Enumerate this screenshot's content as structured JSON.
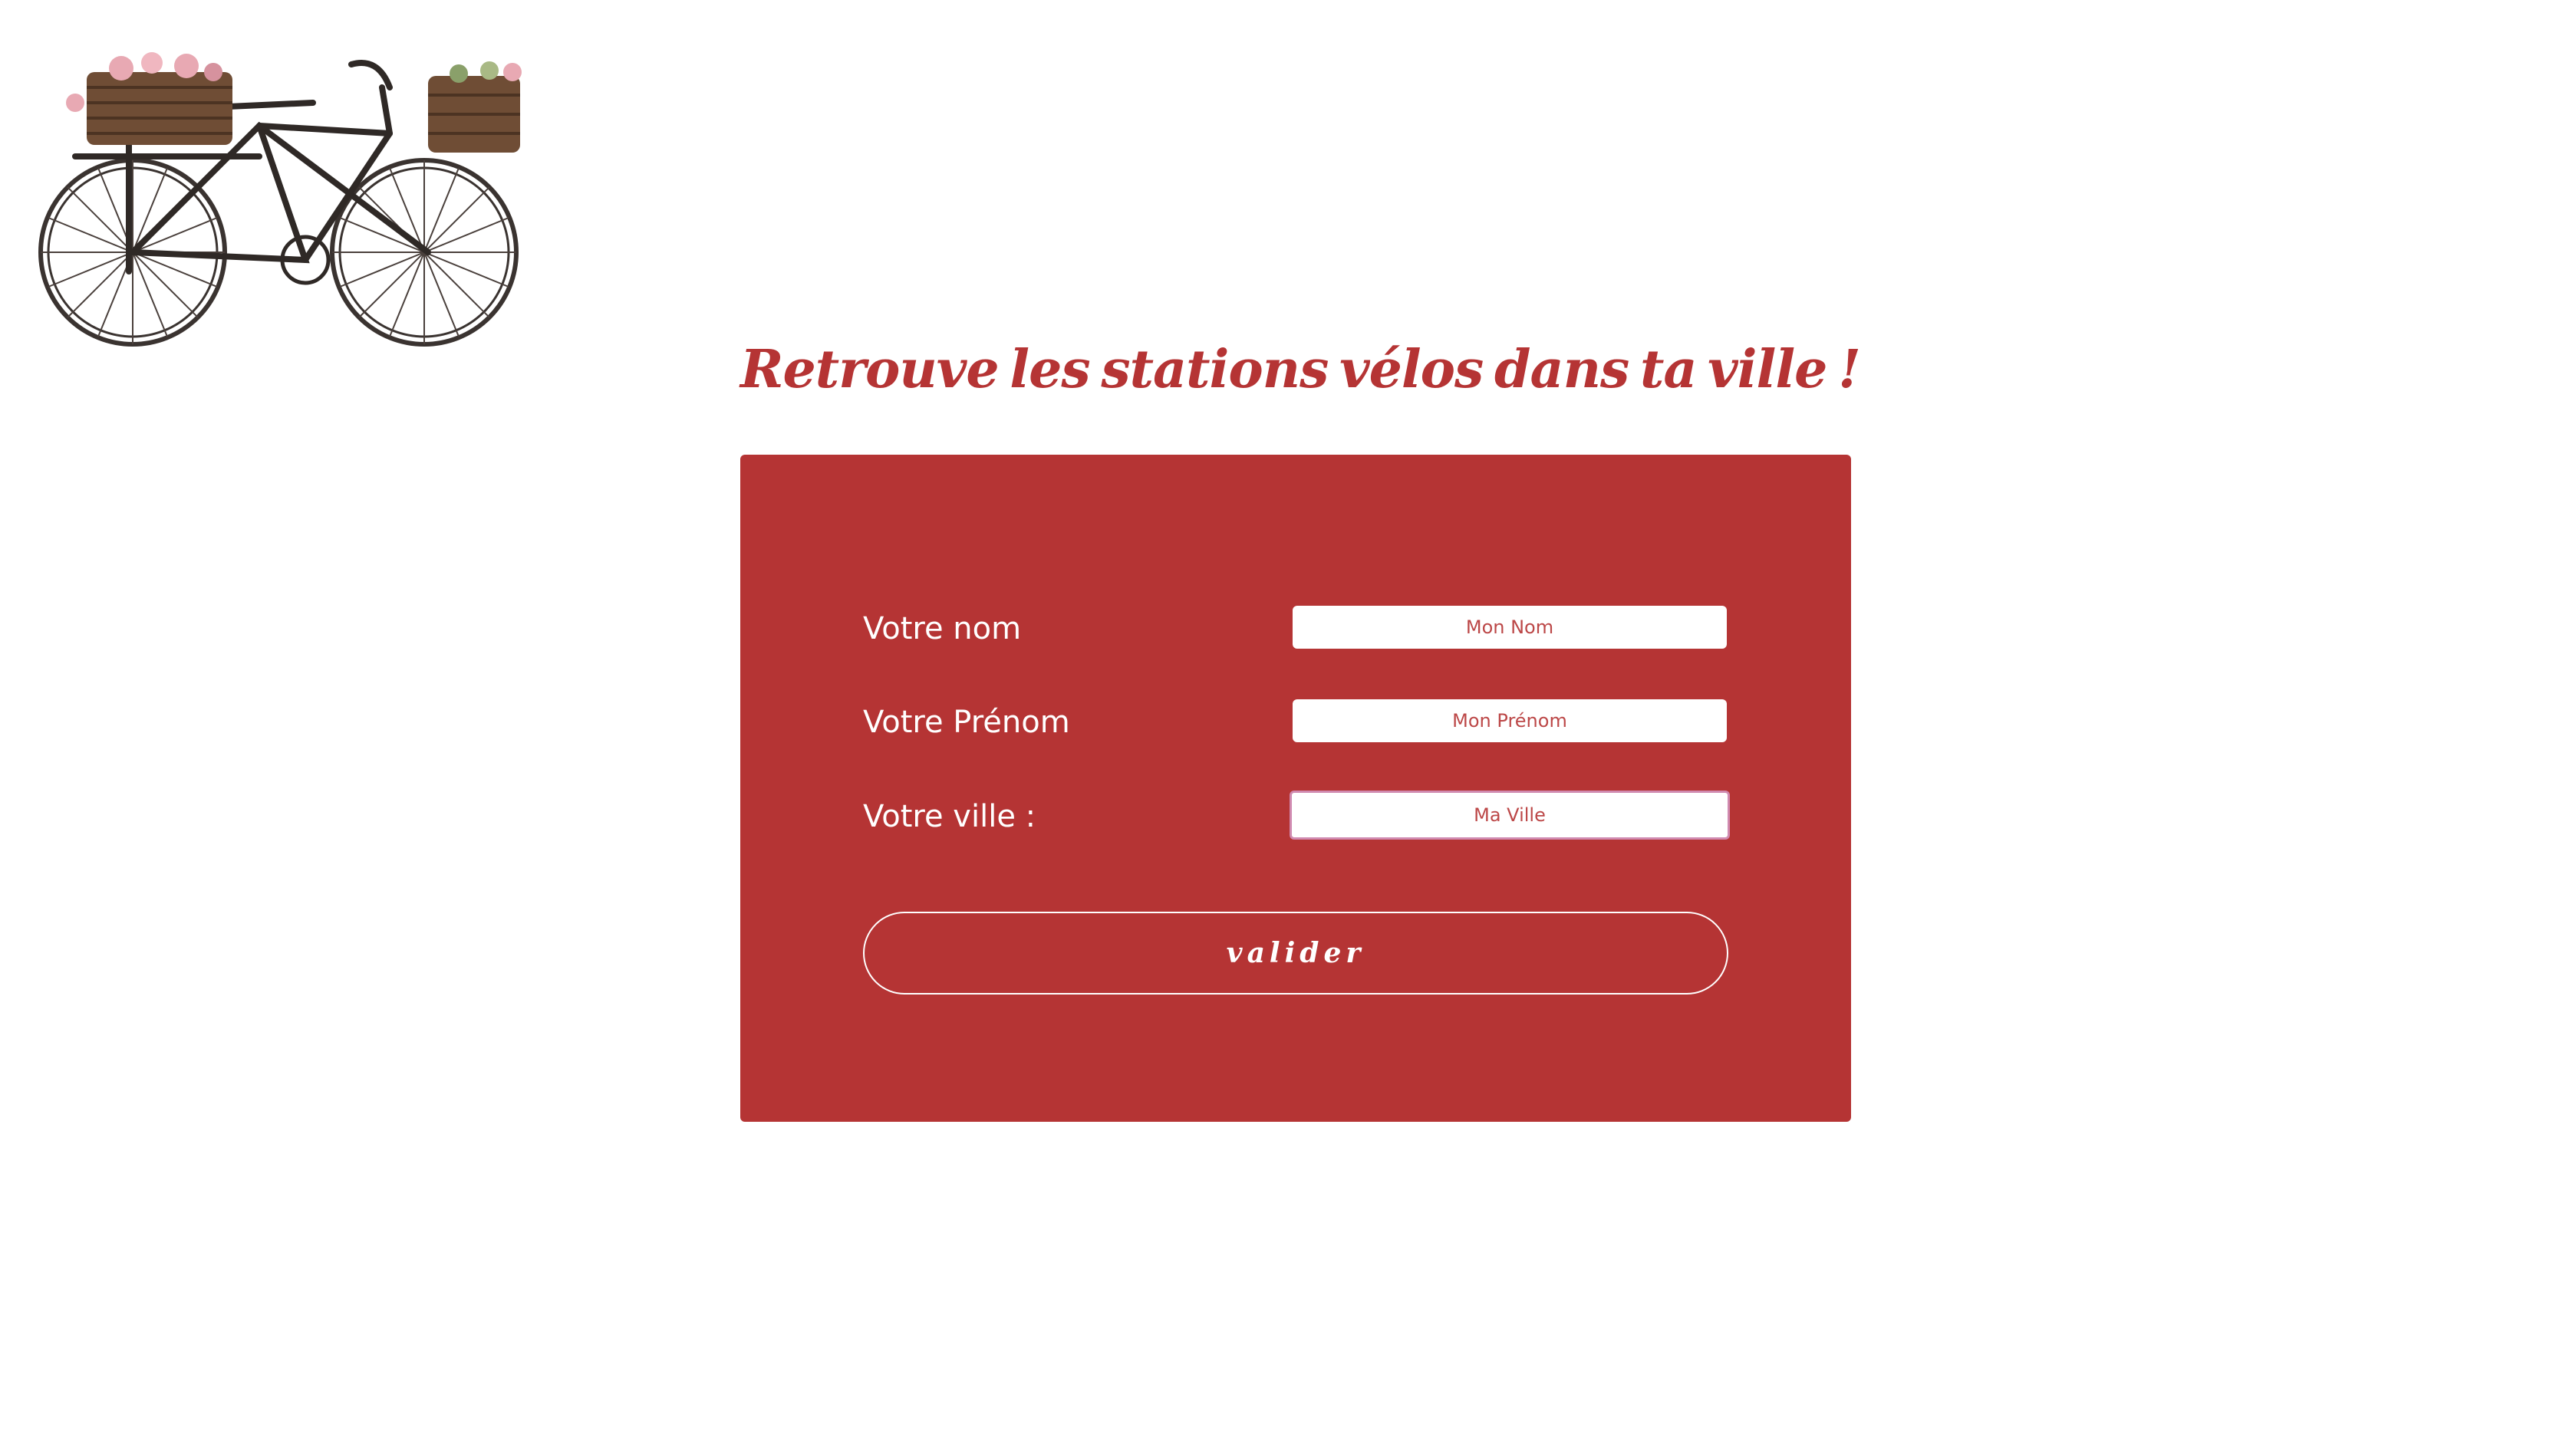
{
  "header": {
    "logo_icon": "bicycle-with-flower-baskets-icon",
    "headline_words": [
      "Retrouve",
      "les",
      "stations",
      "vélos",
      "dans",
      "ta",
      "ville",
      "!"
    ]
  },
  "form": {
    "fields": [
      {
        "label": "Votre nom",
        "placeholder": "Mon Nom",
        "value": ""
      },
      {
        "label": "Votre Prénom",
        "placeholder": "Mon Prénom",
        "value": ""
      },
      {
        "label": "Votre ville :",
        "placeholder": "Ma Ville",
        "value": ""
      }
    ],
    "submit_label": "valider"
  },
  "colors": {
    "accent": "#b53434",
    "background": "#ffffff",
    "panel_text": "#ffffff",
    "focus_ring": "#d08ab0"
  }
}
